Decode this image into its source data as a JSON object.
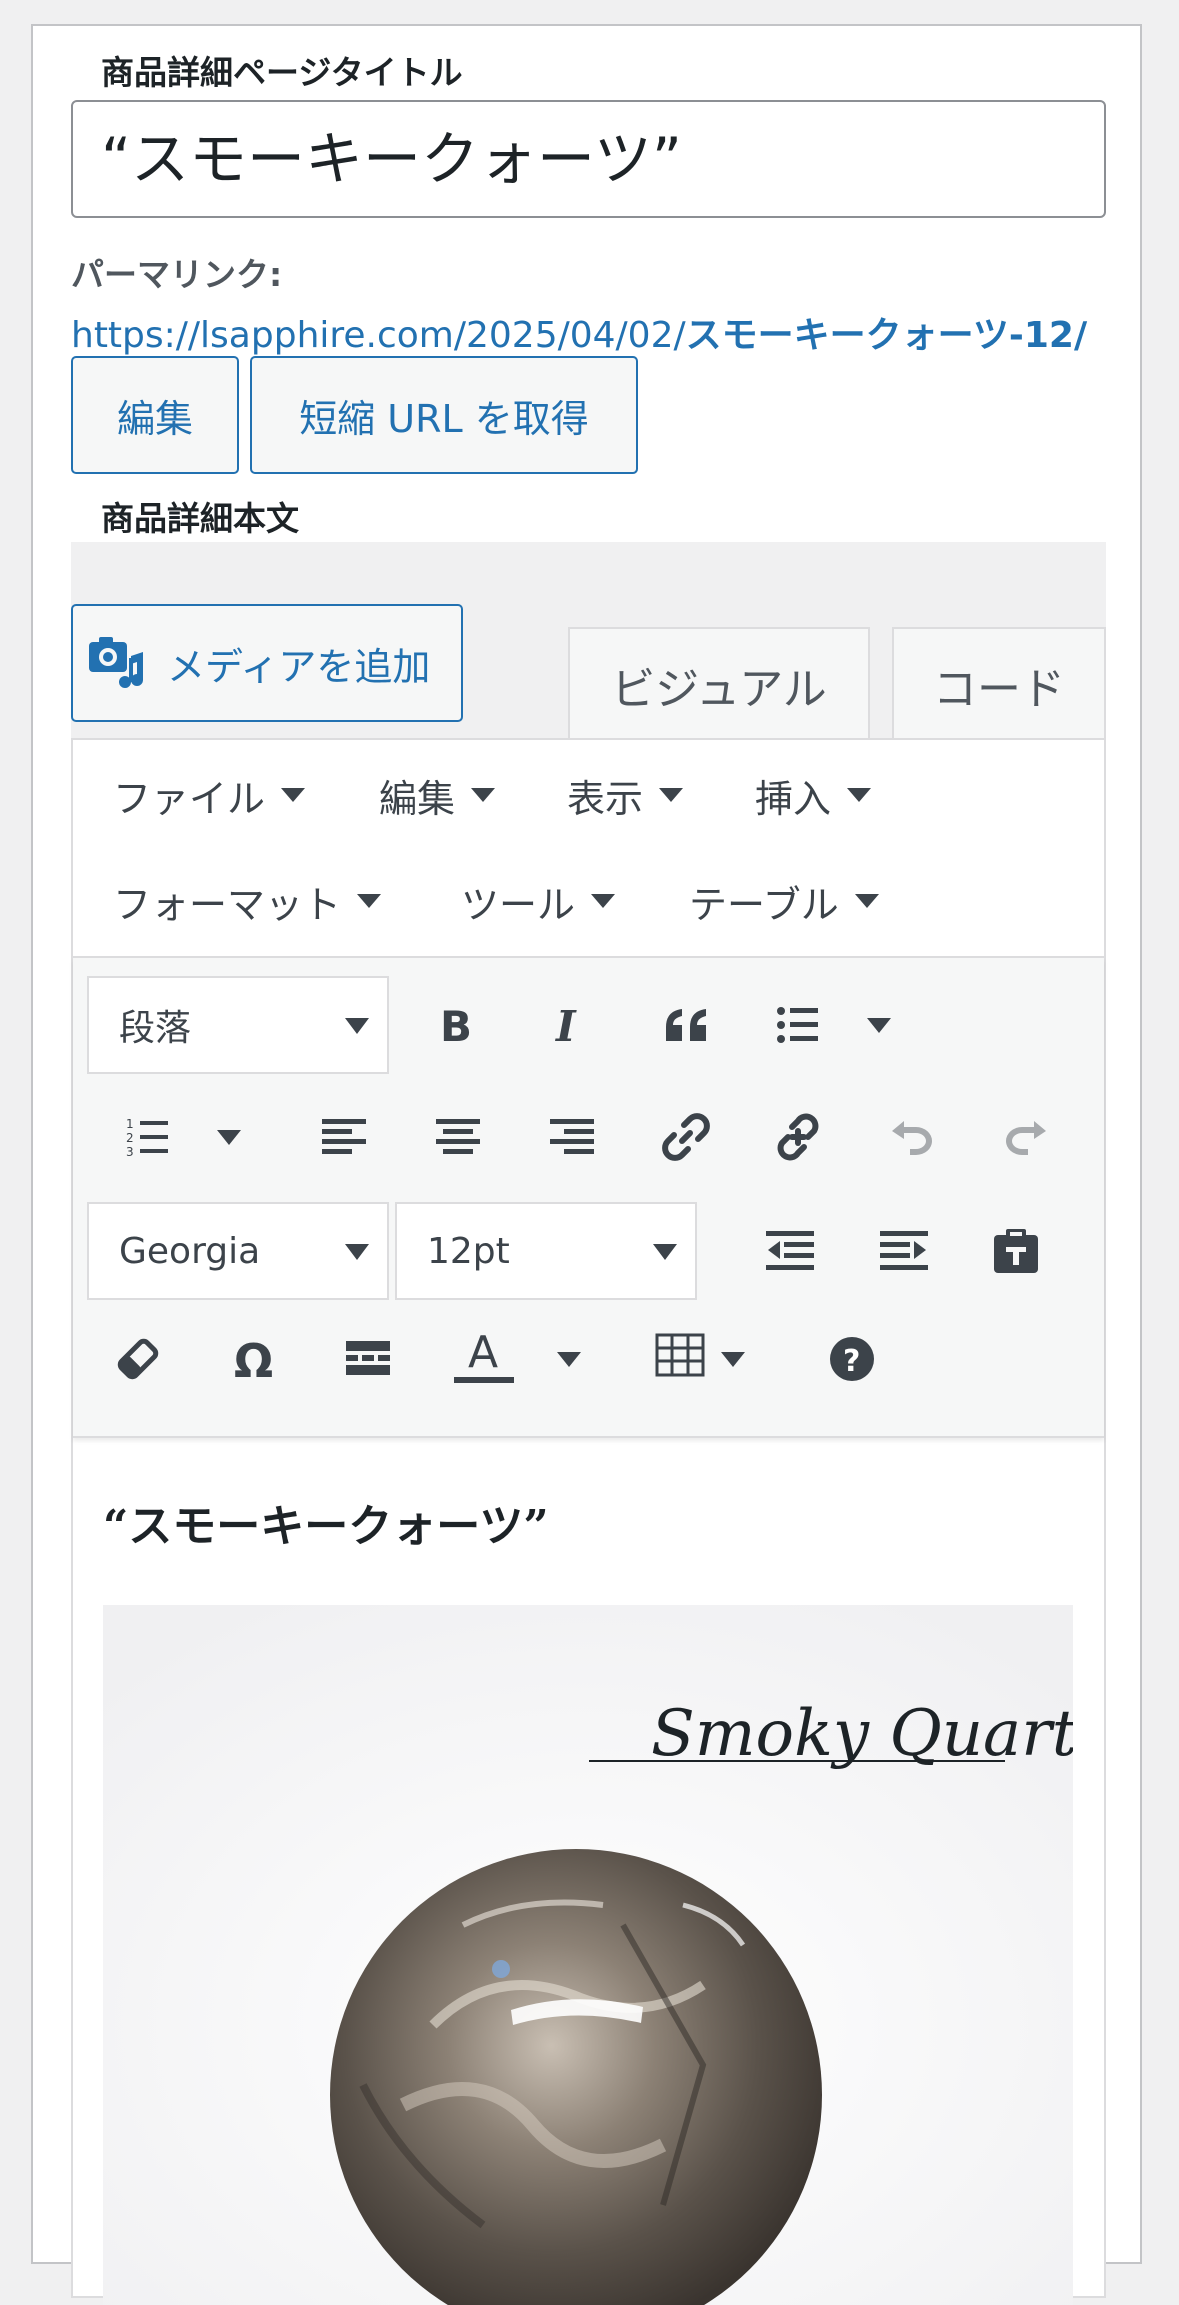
{
  "title_section": {
    "label": "商品詳細ページタイトル",
    "value": "“スモーキークォーツ”"
  },
  "permalink": {
    "label": "パーマリンク:",
    "url_prefix": "https://lsapphire.com/2025/04/02/",
    "url_slug": "スモーキークォーツ-12/",
    "edit_button": "編集",
    "shortlink_button": "短縮 URL を取得"
  },
  "body_section": {
    "label": "商品詳細本文",
    "add_media": "メディアを追加",
    "tabs": {
      "visual": "ビジュアル",
      "code": "コード"
    }
  },
  "menubar": {
    "file": "ファイル",
    "edit": "編集",
    "view": "表示",
    "insert": "挿入",
    "format": "フォーマット",
    "tools": "ツール",
    "table": "テーブル"
  },
  "toolbar": {
    "block_format": "段落",
    "font_family": "Georgia",
    "font_size": "12pt",
    "text_color_letter": "A"
  },
  "content": {
    "heading": "“スモーキークォーツ”",
    "image_caption": "Smoky Quartz"
  },
  "colors": {
    "accent": "#2271b1",
    "icon": "#3c434a",
    "disabled": "#a7aaad"
  }
}
